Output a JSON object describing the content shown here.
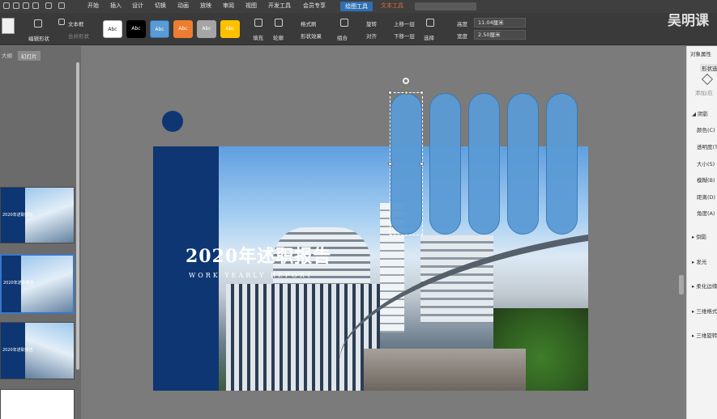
{
  "menu": {
    "items": [
      "开始",
      "插入",
      "设计",
      "切换",
      "动画",
      "放映",
      "审阅",
      "视图",
      "开发工具",
      "会员专享",
      "绘图工具",
      "文本工具"
    ],
    "active_index": 10
  },
  "ribbon": {
    "edit_shape": "编辑形状",
    "text_box": "文本框",
    "merge_shape": "合并形状",
    "style_swatches": [
      "Abc",
      "Abc",
      "Abc",
      "Abc",
      "Abc",
      "Abc"
    ],
    "fill": "填充",
    "outline": "轮廓",
    "format_painter": "格式刷",
    "shape_effect": "形状效果",
    "group": "组合",
    "rotate": "旋转",
    "align": "对齐",
    "bring_forward": "上移一层",
    "send_backward": "下移一层",
    "select": "选择",
    "height_label": "高度",
    "height_value": "11.04厘米",
    "width_label": "宽度",
    "width_value": "2.50厘米"
  },
  "left_panel": {
    "tabs": [
      "大纲",
      "幻灯片"
    ],
    "thumb_title": "2020年述职报告"
  },
  "slide": {
    "title": "2020年述职报告",
    "subtitle": "WORK YEARLY REPORT"
  },
  "right_panel": {
    "title": "对象属性",
    "shape_options": "形状选",
    "add_button": "添加/应",
    "section_fill": "◢ 阴影",
    "fields": [
      "颜色(C)",
      "透明度(T)",
      "大小(S)",
      "模糊(B)",
      "距离(D)",
      "角度(A)"
    ],
    "collapsed": [
      "▸ 倒影",
      "▸ 发光",
      "▸ 柔化边缘",
      "▸ 三维格式",
      "▸ 三维旋转"
    ]
  },
  "watermark": "吴明课",
  "colors": {
    "accent_blue": "#5b9bd5",
    "navy": "#0d3673",
    "ribbon_active": "#2e6fb0"
  }
}
